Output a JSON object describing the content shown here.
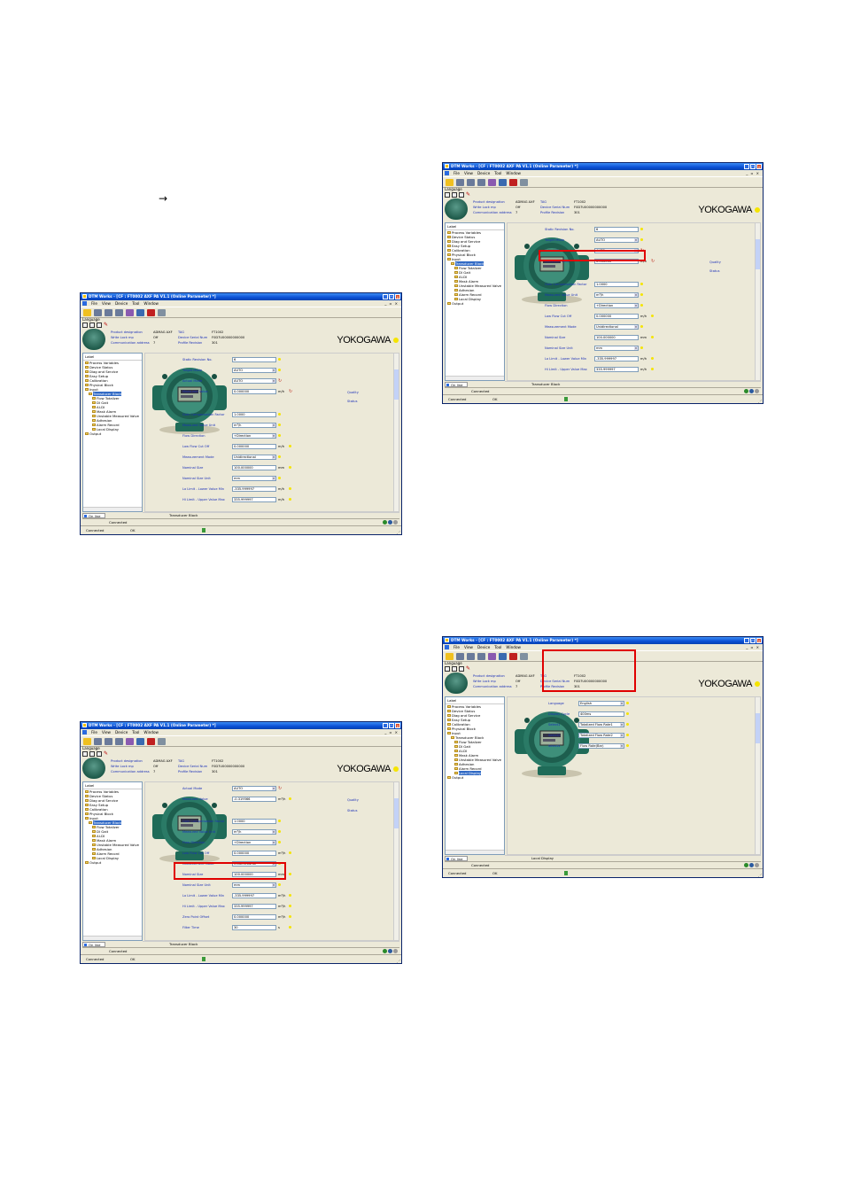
{
  "page": {
    "arrow": "→"
  },
  "common": {
    "title": "DTM Works - [CF : FT0002 AXF PA V1.1 (Online Parameter) *]",
    "menu": [
      "File",
      "View",
      "Device",
      "Tool",
      "Window"
    ],
    "mdi_controls": "_ ▫ ×",
    "language_label": "Language",
    "header": {
      "product_designation_label": "Product designation",
      "product_designation_value": "ADMAG AXF",
      "tag_label": "TAG",
      "tag_value": "FT1002",
      "write_lock_label": "Write Lock mp",
      "write_lock_value": "Off",
      "device_serial_label": "Device Serial Num",
      "device_serial_value": "F0D7U00000000000",
      "comm_address_label": "Communication address",
      "comm_address_value": "7",
      "profile_revision_label": "Profile Revision",
      "profile_revision_value": "301",
      "brand": "YOKOGAWA"
    },
    "tree": {
      "root": "Label",
      "items": [
        "Process Variables",
        "Device Status",
        "Diag and Service",
        "Easy Setup",
        "Calibration",
        "Physical Block",
        "Input",
        "Transducer Block",
        "Flow Totalizer",
        "DI Gait",
        "AI-DI",
        "Mask Alarm",
        "Unstable Measured Valve",
        "Adhesion",
        "Alarm Record",
        "Local Display",
        "Output"
      ]
    },
    "tab_label": "On line",
    "connected": "Connected",
    "status_connected": "Connected",
    "status_ok": "OK",
    "quality_label": "Quality",
    "status_label": "Status"
  },
  "screens": [
    {
      "nav": "Transducer Block",
      "params": [
        {
          "label": "Static Revision No.",
          "value": "6"
        },
        {
          "label": "Target Mode",
          "value": "AUTO"
        },
        {
          "label": "Actual Mode",
          "value": "AUTO"
        },
        {
          "label": "Measured Value",
          "value": "0.000000",
          "unit": "m/h"
        },
        {
          "label": "Gain Compensation Factor",
          "value": "1.0000"
        },
        {
          "label": "Measured Value Unit",
          "value": "m³/h"
        },
        {
          "label": "Flow Direction",
          "value": "+Direction"
        },
        {
          "label": "Low Flow Cut Off",
          "value": "0.000000",
          "unit": "m/h"
        },
        {
          "label": "Measurement Mode",
          "value": "Unidirectional"
        },
        {
          "label": "Nominal Size",
          "value": "100.000000",
          "unit": "mm"
        },
        {
          "label": "Nominal Size Unit",
          "value": "mm"
        },
        {
          "label": "Lo Limit - Lower Value Min",
          "value": "-335.999997",
          "unit": "m/h"
        },
        {
          "label": "Hi Limit - Upper Value Max",
          "value": "335.999997",
          "unit": "m/h"
        }
      ]
    },
    {
      "nav": "Transducer Block",
      "params": [
        {
          "label": "Static Revision No.",
          "value": "6"
        },
        {
          "label": "Target Mode",
          "value": "AUTO"
        },
        {
          "label": "Actual Mode",
          "value": "AUTO"
        },
        {
          "label": "Measured Value",
          "value": "0.000000",
          "unit": "m/h"
        },
        {
          "label": "Gain Compensation Factor",
          "value": "1.0000"
        },
        {
          "label": "Measured Value Unit",
          "value": "m³/h"
        },
        {
          "label": "Flow Direction",
          "value": "+Direction"
        },
        {
          "label": "Low Flow Cut Off",
          "value": "0.000000",
          "unit": "m/h"
        },
        {
          "label": "Measurement Mode",
          "value": "Unidirectional"
        },
        {
          "label": "Nominal Size",
          "value": "100.000000",
          "unit": "mm"
        },
        {
          "label": "Nominal Size Unit",
          "value": "mm"
        },
        {
          "label": "Lo Limit - Lower Value Min",
          "value": "-335.999997",
          "unit": "m/h"
        },
        {
          "label": "Hi Limit - Upper Value Max",
          "value": "335.999997",
          "unit": "m/h"
        }
      ]
    },
    {
      "nav": "Transducer Block",
      "params": [
        {
          "label": "Actual Mode",
          "value": "AUTO"
        },
        {
          "label": "Measured Value",
          "value": "-0.319566",
          "unit": "m³/h"
        },
        {
          "label": "Gain Compensation Factor",
          "value": "1.0000"
        },
        {
          "label": "Measured Value Unit",
          "value": "m³/h"
        },
        {
          "label": "Flow Direction",
          "value": "+Direction"
        },
        {
          "label": "Low Flow Cut Off",
          "value": "0.000000",
          "unit": "m³/h"
        },
        {
          "label": "Measurement Mode",
          "value": "Unidirectional"
        },
        {
          "label": "Nominal Size",
          "value": "100.000000",
          "unit": "mm"
        },
        {
          "label": "Nominal Size Unit",
          "value": "mm"
        },
        {
          "label": "Lo Limit - Lower Value Min",
          "value": "-335.999997",
          "unit": "m³/h"
        },
        {
          "label": "Hi Limit - Upper Value Max",
          "value": "335.999997",
          "unit": "m³/h"
        },
        {
          "label": "Zero Point Offset",
          "value": "0.000000",
          "unit": "m³/h"
        },
        {
          "label": "Filter Time",
          "value": "30",
          "unit": "s"
        }
      ]
    },
    {
      "nav": "Local Display",
      "params": [
        {
          "label": "Language",
          "value": "English"
        },
        {
          "label": "Display Cycle",
          "value": "400ms"
        },
        {
          "label": "Select1",
          "value": "Totalized Flow Rate1"
        },
        {
          "label": "Select2",
          "value": "Totalized Flow Rate2"
        },
        {
          "label": "Select3",
          "value": "Flow Rate(Bar)"
        }
      ]
    }
  ]
}
